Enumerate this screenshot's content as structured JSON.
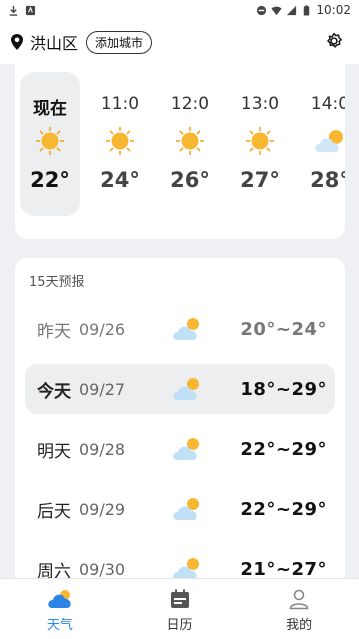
{
  "status_bar": {
    "time": "10:02",
    "battery": "◼"
  },
  "header": {
    "location": "洪山区",
    "add_city": "添加城市"
  },
  "hourly": [
    {
      "label": "现在",
      "temp": "22°",
      "icon": "sun-icon",
      "now": true
    },
    {
      "label": "11:0",
      "temp": "24°",
      "icon": "sun-icon"
    },
    {
      "label": "12:0",
      "temp": "26°",
      "icon": "sun-icon"
    },
    {
      "label": "13:0",
      "temp": "27°",
      "icon": "sun-icon"
    },
    {
      "label": "14:0",
      "temp": "28°",
      "icon": "partly-cloudy-icon"
    }
  ],
  "forecast": {
    "title": "15天预报",
    "days": [
      {
        "name": "昨天",
        "date": "09/26",
        "temp": "20°~24°",
        "icon": "partly-cloudy-icon"
      },
      {
        "name": "今天",
        "date": "09/27",
        "temp": "18°~29°",
        "icon": "partly-cloudy-icon"
      },
      {
        "name": "明天",
        "date": "09/28",
        "temp": "22°~29°",
        "icon": "partly-cloudy-icon"
      },
      {
        "name": "后天",
        "date": "09/29",
        "temp": "22°~29°",
        "icon": "partly-cloudy-icon"
      },
      {
        "name": "周六",
        "date": "09/30",
        "temp": "21°~27°",
        "icon": "partly-cloudy-icon"
      }
    ]
  },
  "nav": [
    {
      "label": "天气",
      "icon": "weather-cloud-icon",
      "active": true
    },
    {
      "label": "日历",
      "icon": "calendar-icon"
    },
    {
      "label": "我的",
      "icon": "profile-icon"
    }
  ],
  "colors": {
    "accent": "#2a85e6",
    "sun": "#f5a623",
    "cloud": "#bfe0f7"
  }
}
